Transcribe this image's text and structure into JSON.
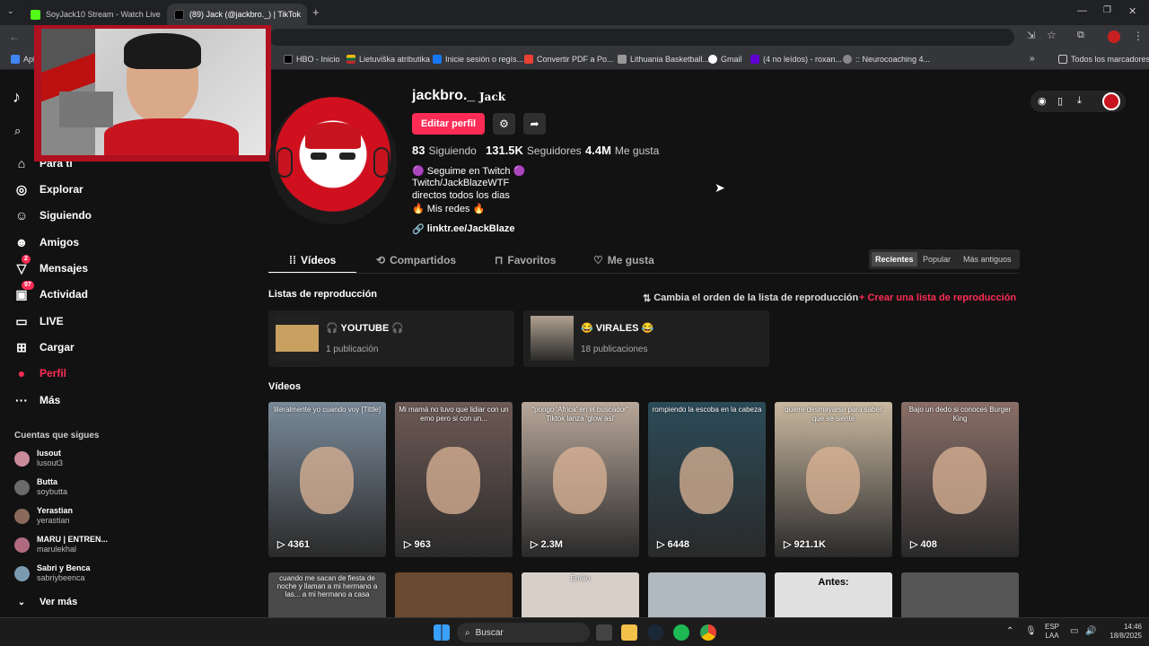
{
  "browser": {
    "tabs": [
      {
        "title": "SoyJack10 Stream - Watch Live",
        "favicon_color": "#53fc18"
      },
      {
        "title": "(89) Jack (@jackbro._) | TikTok",
        "favicon_color": "#000000"
      }
    ],
    "new_tab": "+",
    "bookmarks": [
      {
        "label": "Apl",
        "color": "#4285f4"
      },
      {
        "label": "HBO - Inicio",
        "color": "#000000"
      },
      {
        "label": "Lietuviška atributika",
        "color": "#fdb913"
      },
      {
        "label": "Inicie sesión o regís...",
        "color": "#1877f2"
      },
      {
        "label": "Convertir PDF a Po...",
        "color": "#e94235"
      },
      {
        "label": "Lithuania Basketball...",
        "color": "#999999"
      },
      {
        "label": "Gmail",
        "color": "#ea4335"
      },
      {
        "label": "(4 no leídos) - roxan...",
        "color": "#6001d2"
      },
      {
        "label": ":: Neurocoaching 4...",
        "color": "#888888"
      }
    ],
    "bookmarks_more": "»",
    "all_bookmarks": "Todos los marcadores"
  },
  "sidebar": {
    "items": [
      {
        "label": "Para ti",
        "icon": "home-icon",
        "glyph": "⌂"
      },
      {
        "label": "Explorar",
        "icon": "compass-icon",
        "glyph": "◎"
      },
      {
        "label": "Siguiendo",
        "icon": "following-icon",
        "glyph": "☺"
      },
      {
        "label": "Amigos",
        "icon": "friends-icon",
        "glyph": "☻"
      },
      {
        "label": "Mensajes",
        "icon": "messages-icon",
        "glyph": "▽",
        "badge": "2"
      },
      {
        "label": "Actividad",
        "icon": "activity-icon",
        "glyph": "▣",
        "badge": "97"
      },
      {
        "label": "LIVE",
        "icon": "live-icon",
        "glyph": "▭"
      },
      {
        "label": "Cargar",
        "icon": "upload-icon",
        "glyph": "⊞"
      },
      {
        "label": "Perfil",
        "icon": "profile-icon",
        "glyph": "●",
        "active": true
      },
      {
        "label": "Más",
        "icon": "more-icon",
        "glyph": "···"
      }
    ],
    "following_title": "Cuentas que sigues",
    "following": [
      {
        "name": "lusout",
        "handle": "lusout3",
        "color": "#c98a9a"
      },
      {
        "name": "Butta",
        "handle": "soybutta",
        "color": "#6a6a6a"
      },
      {
        "name": "Yerastian",
        "handle": "yerastian",
        "color": "#8a6a5a"
      },
      {
        "name": "MARU | ENTREN...",
        "handle": "marulekhal",
        "color": "#b06a80"
      },
      {
        "name": "Sabri y Benca",
        "handle": "sabriybeenca",
        "color": "#7a9ab0"
      }
    ],
    "see_more": "Ver más"
  },
  "profile": {
    "username": "jackbro._",
    "display_name": "Jack",
    "edit_button": "Editar perfil",
    "stats": {
      "following": "83",
      "following_label": "Siguiendo",
      "followers": "131.5K",
      "followers_label": "Seguidores",
      "likes": "4.4M",
      "likes_label": "Me gusta"
    },
    "bio": [
      "🟣 Seguime en Twitch 🟣",
      "Twitch/JackBlazeWTF",
      "directos todos los dias",
      "🔥 Mis redes 🔥"
    ],
    "link": "linktr.ee/JackBlaze"
  },
  "tabs": [
    {
      "label": "Vídeos",
      "active": true
    },
    {
      "label": "Compartidos"
    },
    {
      "label": "Favoritos"
    },
    {
      "label": "Me gusta"
    }
  ],
  "sort": {
    "options": [
      "Recientes",
      "Popular",
      "Más antiguos"
    ],
    "selected": "Recientes"
  },
  "playlists": {
    "title": "Listas de reproducción",
    "reorder": "Cambia el orden de la lista de reproducción",
    "create": "+ Crear una lista de reproducción",
    "items": [
      {
        "title": "🎧 YOUTUBE 🎧",
        "count": "1 publicación"
      },
      {
        "title": "😂 VIRALES 😂",
        "count": "18 publicaciones"
      }
    ]
  },
  "videos_title": "Vídeos",
  "videos": [
    {
      "caption": "literalmente yo cuando voy [Tittle]",
      "views": "4361",
      "bg": "#7a8a9a"
    },
    {
      "caption": "Mi mamá no tuvo que lidiar con un emo pero si con un...",
      "views": "963",
      "bg": "#6e5a55"
    },
    {
      "caption": "\"pongo 'Africa' en el buscador\" Tiktok lanza 'glow asi'",
      "views": "2.3M",
      "bg": "#b8a79a"
    },
    {
      "caption": "rompiendo la escoba en la cabeza",
      "views": "6448",
      "bg": "#2c4b58"
    },
    {
      "caption": "quiere desmayarse para saber que se siente",
      "views": "921.1K",
      "bg": "#c9b8a0"
    },
    {
      "caption": "Bajo un dedo si conoces Burger King",
      "views": "408",
      "bg": "#8a6f68"
    }
  ],
  "videos_row2": [
    {
      "caption": "cuando me sacan de fiesta de noche y llaman a mi hermano a las... a mi hermano a casa",
      "bg": "#4a4a4a"
    },
    {
      "caption": "",
      "bg": "#6a4a30"
    },
    {
      "caption": "Emilio",
      "bg": "#d8d0c8"
    },
    {
      "caption": "",
      "bg": "#b0b8c0"
    },
    {
      "caption": "Antes:",
      "bg": "#e0e0e0"
    },
    {
      "caption": "",
      "bg": "#555555"
    }
  ],
  "taskbar": {
    "search": "Buscar",
    "lang1": "ESP",
    "lang2": "LAA",
    "time": "14:46",
    "date": "18/8/2025"
  }
}
